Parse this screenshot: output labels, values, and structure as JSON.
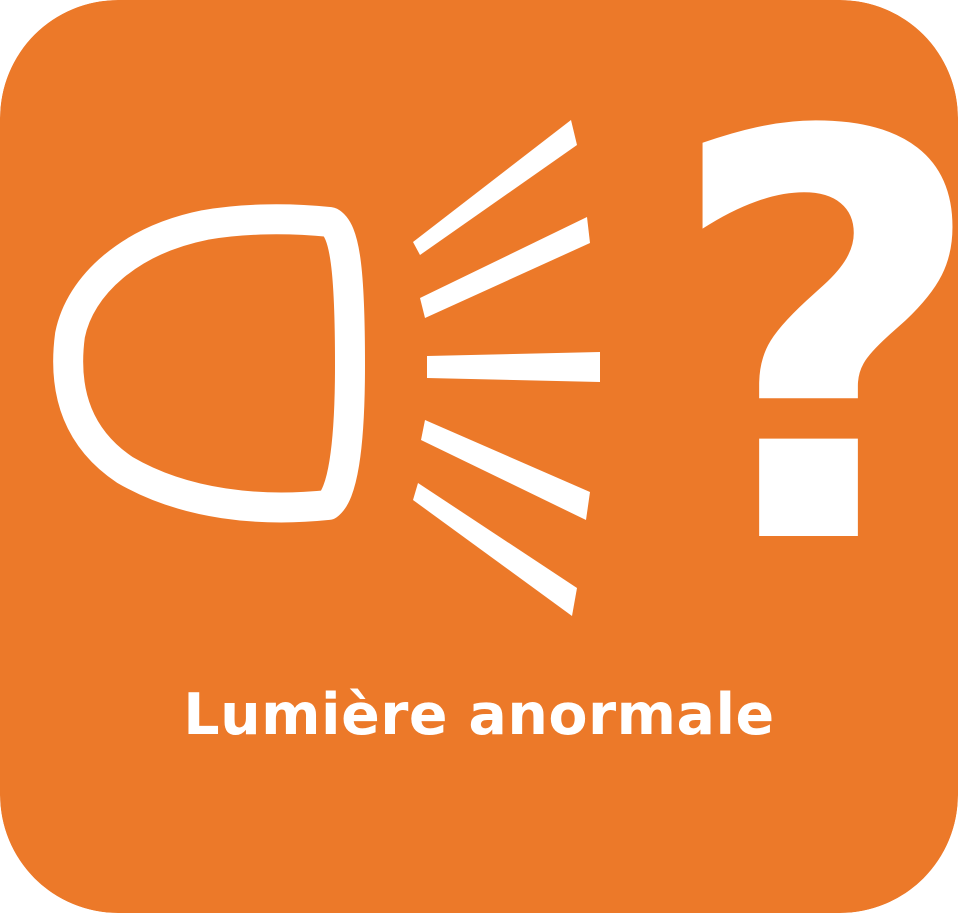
{
  "icon": {
    "name": "headlight-icon",
    "background_color": "#EC7929",
    "foreground_color": "#FFFFFF",
    "symbol": "?",
    "caption": "Lumière anormale"
  }
}
